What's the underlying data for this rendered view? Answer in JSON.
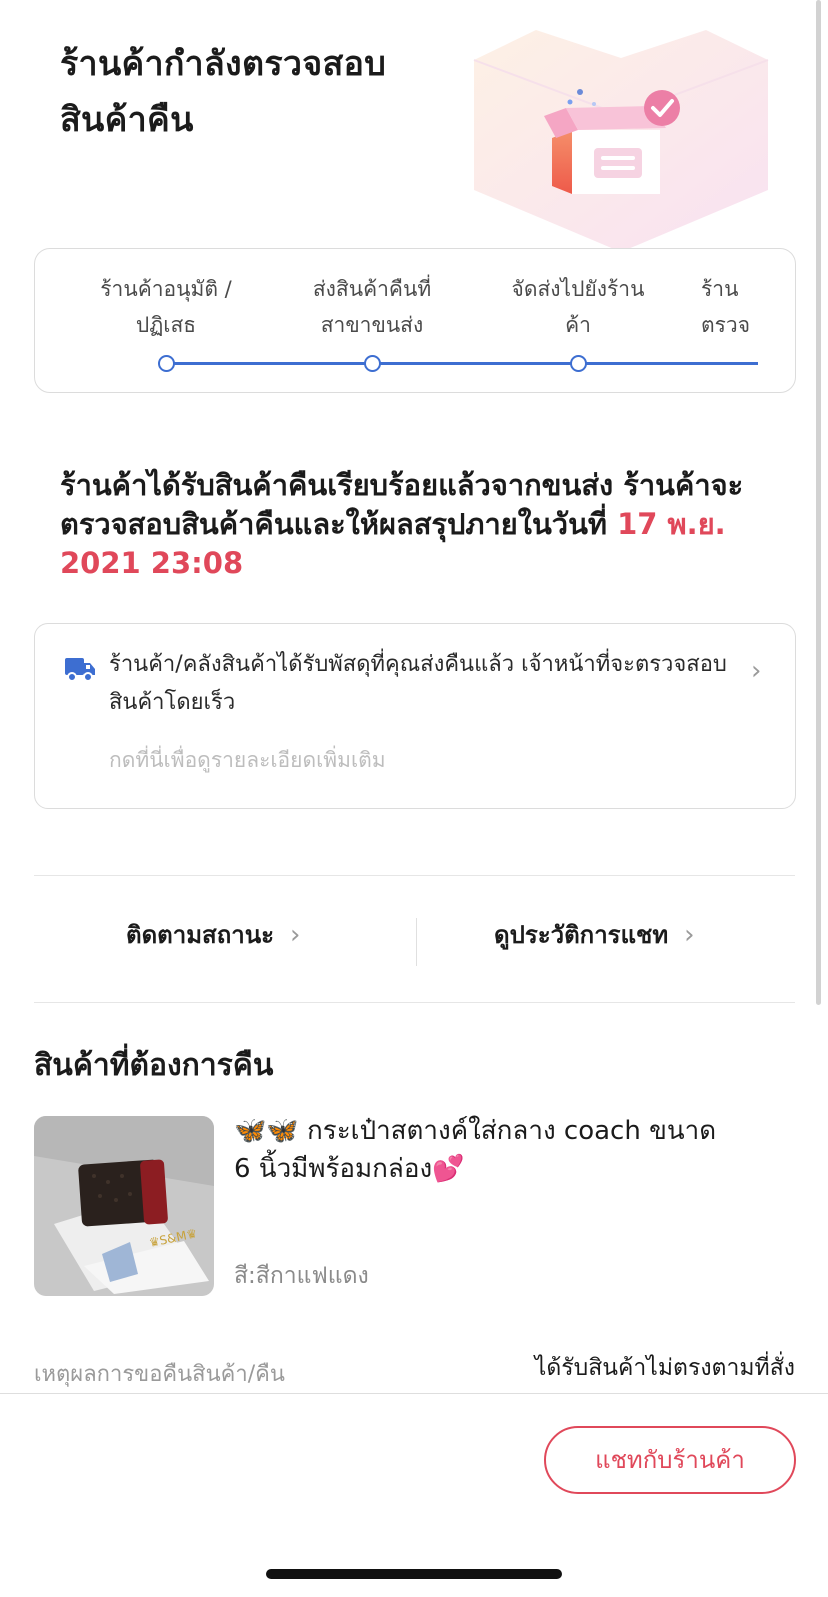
{
  "header": {
    "title_line1": "ร้านค้ากำลังตรวจสอบ",
    "title_line2": "สินค้าคืน"
  },
  "progress": {
    "steps": [
      {
        "line1": "ร้านค้าอนุมัติ /",
        "line2": "ปฏิเสธ"
      },
      {
        "line1": "ส่งสินค้าคืนที่",
        "line2": "สาขาขนส่ง"
      },
      {
        "line1": "จัดส่งไปยังร้าน",
        "line2": "ค้า"
      },
      {
        "line1": "ร้าน",
        "line2": "ตรวจ"
      }
    ],
    "accent_color": "#3d6ed1"
  },
  "status": {
    "text": "ร้านค้าได้รับสินค้าคืนเรียบร้อยแล้วจากขนส่ง ร้านค้าจะตรวจสอบสินค้าคืนและให้ผลสรุปภายในวันที่ ",
    "deadline": "17 พ.ย. 2021 23:08",
    "highlight_color": "#e0485a"
  },
  "info": {
    "icon": "truck-icon",
    "message": "ร้านค้า/คลังสินค้าได้รับพัสดุที่คุณส่งคืนแล้ว เจ้าหน้าที่จะตรวจสอบสินค้าโดยเร็ว",
    "hint": "กดที่นี่เพื่อดูรายละเอียดเพิ่มเติม"
  },
  "actions": {
    "track_status": "ติดตามสถานะ",
    "chat_history": "ดูประวัติการแชท"
  },
  "return_items": {
    "title": "สินค้าที่ต้องการคืน",
    "product": {
      "name": "🦋🦋 กระเป๋าสตางค์ใส่กลาง coach ขนาด 6 นิ้วมีพร้อมกล่อง💕",
      "variant": "สี:สีกาแฟแดง"
    }
  },
  "reason": {
    "label": "เหตุผลการขอคืนสินค้า/คืน",
    "value": "ได้รับสินค้าไม่ตรงตามที่สั่ง"
  },
  "footer": {
    "chat_button": "แชทกับร้านค้า"
  }
}
